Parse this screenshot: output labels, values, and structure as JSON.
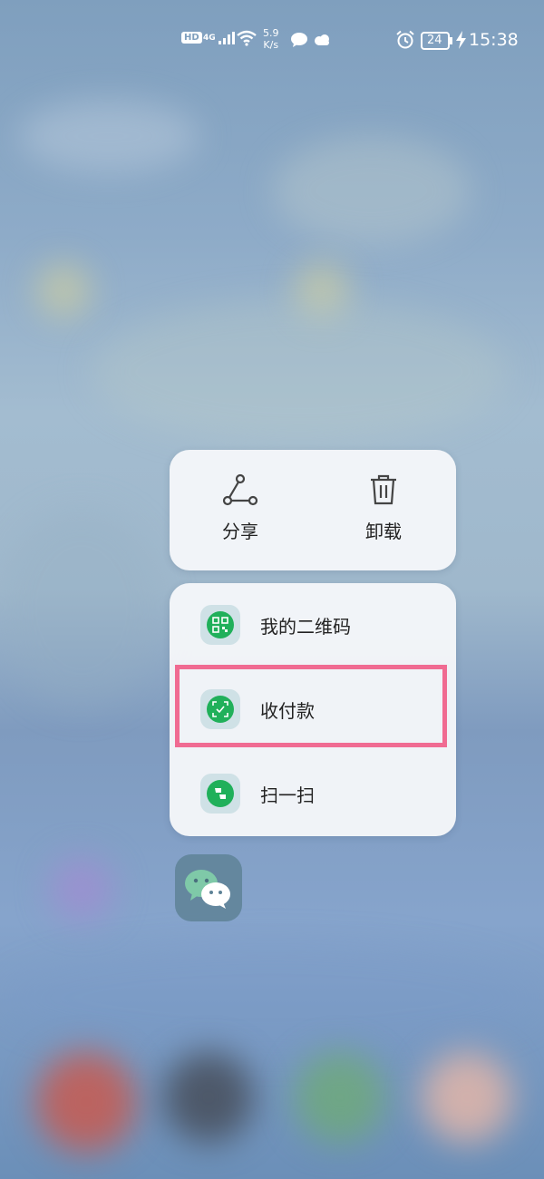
{
  "status_bar": {
    "hd_label": "HD",
    "network_label": "4G",
    "speed_value": "5.9",
    "speed_unit": "K/s",
    "battery": "24",
    "time": "15:38",
    "icons": [
      "signal-icon",
      "wifi-icon",
      "message-icon",
      "cloud-icon",
      "alarm-icon",
      "battery-icon",
      "charging-icon"
    ]
  },
  "quick_actions": {
    "share_label": "分享",
    "uninstall_label": "卸载"
  },
  "shortcut_menu": {
    "items": [
      {
        "label": "我的二维码",
        "icon": "qr-code-icon"
      },
      {
        "label": "收付款",
        "icon": "payment-scan-icon"
      },
      {
        "label": "扫一扫",
        "icon": "scan-icon"
      }
    ],
    "highlighted_index": 1
  },
  "app": {
    "icon": "wechat-icon"
  },
  "colors": {
    "accent_green": "#20b05a",
    "highlight_pink": "#f06b92",
    "menu_bg": "#f4f6f9"
  }
}
